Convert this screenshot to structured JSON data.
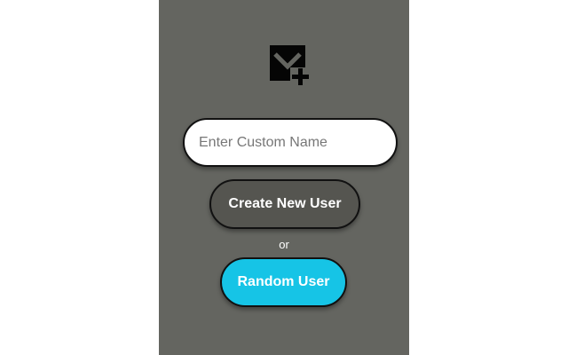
{
  "icon": "mail-plus-icon",
  "colors": {
    "panel_background": "#646560",
    "create_button": "#555550",
    "random_button": "#16c4e6",
    "text_light": "#ffffff"
  },
  "form": {
    "name_placeholder": "Enter Custom Name",
    "name_value": "",
    "create_label": "Create New User",
    "separator": "or",
    "random_label": "Random User"
  }
}
